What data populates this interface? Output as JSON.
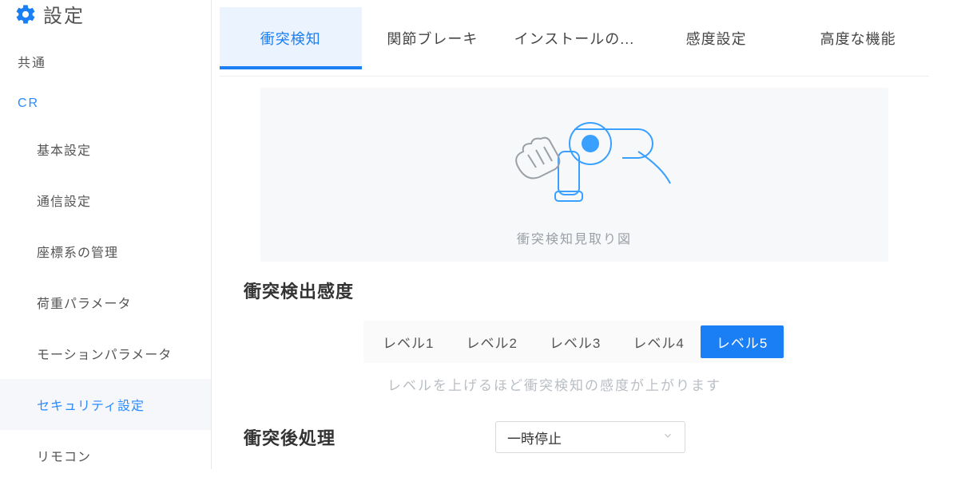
{
  "sidebar": {
    "title": "設定",
    "categories": {
      "common": "共通",
      "cr": "CR"
    },
    "items": [
      "基本設定",
      "通信設定",
      "座標系の管理",
      "荷重パラメータ",
      "モーションパラメータ",
      "セキュリティ設定",
      "リモコン"
    ],
    "active_index": 5
  },
  "tabs": {
    "items": [
      "衝突検知",
      "関節ブレーキ",
      "インストールの...",
      "感度設定",
      "高度な機能"
    ],
    "active_index": 0
  },
  "diagram_caption": "衝突検知見取り図",
  "sensitivity": {
    "title": "衝突検出感度",
    "levels": [
      "レベル1",
      "レベル2",
      "レベル3",
      "レベル4",
      "レベル5"
    ],
    "active_index": 4,
    "hint": "レベルを上げるほど衝突検知の感度が上がります"
  },
  "post": {
    "title": "衝突後処理",
    "selected": "一時停止"
  }
}
